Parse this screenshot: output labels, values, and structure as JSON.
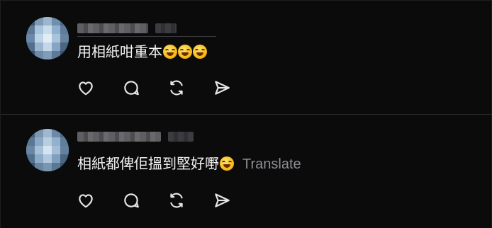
{
  "comments": [
    {
      "text": "用相紙咁重本",
      "emoji_count": 3,
      "emoji_icon": "laughing-face-icon",
      "translate_label": ""
    },
    {
      "text": "相紙都俾佢搵到堅好嘢",
      "emoji_count": 1,
      "emoji_icon": "exploding-head-icon",
      "translate_label": "Translate"
    }
  ],
  "actions": [
    "heart-icon",
    "comment-icon",
    "repost-icon",
    "share-icon"
  ],
  "colors": {
    "background": "#0b0b0c",
    "text": "#f2f2f2",
    "muted": "#8e8e93",
    "divider": "#2a2a2d"
  }
}
